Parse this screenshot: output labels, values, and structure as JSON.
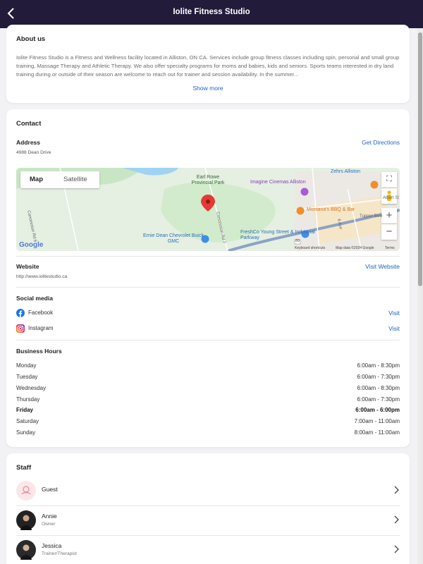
{
  "header": {
    "title": "Iolite Fitness Studio"
  },
  "about": {
    "heading": "About us",
    "text": "Iolite Fitness Studio is a Fitness and Wellness facility located in Alliston, ON CA. Services include group fitness classes including spin, personal and small group training, Massage Therapy and Athletic Therapy. We also offer specialty programs for moms and babies, kids and seniors. Sports teams interested in dry land training during or outside of their season are welcome to reach out for trainer and session availability. In the summer...",
    "show_more": "Show more"
  },
  "contact": {
    "heading": "Contact",
    "address_label": "Address",
    "address": "4988 Dean Drive",
    "directions": "Get Directions",
    "map": {
      "tab_map": "Map",
      "tab_satellite": "Satellite",
      "labels": {
        "park": "Earl Rowe Provincial Park",
        "cinema": "Imagine Cinemas Alliston",
        "zehrs": "Zehrs Alliston",
        "montanas": "Montana's BBQ & Bar",
        "freshco": "FreshCo Young Street & Industrial Parkway",
        "ernie": "Ernie Dean Chevrolet Buick GMC",
        "concession6": "Concession Rd 6",
        "concession7": "Concession Rd 7",
        "albert": "Albert St",
        "tupper": "Tupper Blvd",
        "road_8": "8 Ave",
        "shield": "89",
        "google": "Google",
        "shortcuts": "Keyboard shortcuts",
        "mapdata": "Map data ©2024 Google",
        "terms": "Terms"
      }
    },
    "website_label": "Website",
    "website_url": "http://www.iolitestudio.ca",
    "visit_website": "Visit Website",
    "social_label": "Social media",
    "social": [
      {
        "name": "Facebook",
        "action": "Visit"
      },
      {
        "name": "Instagram",
        "action": "Visit"
      }
    ],
    "hours_label": "Business Hours",
    "hours": [
      {
        "day": "Monday",
        "time": "6:00am - 8:30pm"
      },
      {
        "day": "Tuesday",
        "time": "6:00am - 7:30pm"
      },
      {
        "day": "Wednesday",
        "time": "6:00am - 8:30pm"
      },
      {
        "day": "Thursday",
        "time": "6:00am - 7:30pm"
      },
      {
        "day": "Friday",
        "time": "6:00am - 6:00pm"
      },
      {
        "day": "Saturday",
        "time": "7:00am - 11:00am"
      },
      {
        "day": "Sunday",
        "time": "8:00am - 11:00am"
      }
    ]
  },
  "staff": {
    "heading": "Staff",
    "members": [
      {
        "name": "Guest",
        "role": ""
      },
      {
        "name": "Annie",
        "role": "Owner"
      },
      {
        "name": "Jessica",
        "role": "Trainer/Therapist"
      }
    ]
  },
  "colors": {
    "header_bg": "#221b3a",
    "link": "#1e63c4",
    "page_bg": "#f2f2f4"
  },
  "icons": {
    "back": "chevron-left-icon",
    "facebook": "facebook-icon",
    "instagram": "instagram-icon",
    "chevron": "chevron-right-icon"
  }
}
